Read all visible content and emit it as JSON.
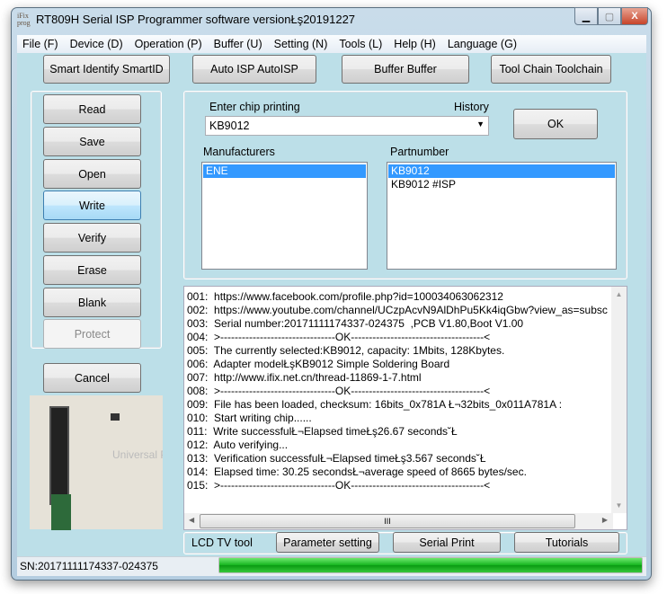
{
  "window": {
    "title": "RT809H Serial ISP Programmer software versionŁş20191227",
    "logo": "iFix prog",
    "controls": [
      "minimize",
      "maximize",
      "close"
    ]
  },
  "menu": [
    "File (F)",
    "Device (D)",
    "Operation (P)",
    "Buffer (U)",
    "Setting (N)",
    "Tools (L)",
    "Help (H)",
    "Language (G)"
  ],
  "toolbar": [
    "Smart Identify SmartID",
    "Auto ISP AutoISP",
    "Buffer Buffer",
    "Tool Chain Toolchain"
  ],
  "ops": {
    "buttons": [
      "Read",
      "Save",
      "Open",
      "Write",
      "Verify",
      "Erase",
      "Blank",
      "Protect"
    ],
    "active": "Write",
    "disabled": "Protect",
    "cancel": "Cancel"
  },
  "chip": {
    "label": "Enter chip printing",
    "history_label": "History",
    "value": "KB9012",
    "ok": "OK",
    "manufacturers_label": "Manufacturers",
    "manufacturers": [
      "ENE"
    ],
    "selected_manufacturer": "ENE",
    "partnumber_label": "Partnumber",
    "partnumbers": [
      "KB9012",
      "KB9012 #ISP"
    ],
    "selected_partnumber": "KB9012"
  },
  "log": [
    "001:  https://www.facebook.com/profile.php?id=100034063062312",
    "002:  https://www.youtube.com/channel/UCzpAcvN9AlDhPu5Kk4iqGbw?view_as=subsc",
    "003:  Serial number:20171111174337-024375  ,PCB V1.80,Boot V1.00",
    "004:  >--------------------------------OK-------------------------------------<",
    "005:  The currently selected:KB9012, capacity: 1Mbits, 128Kbytes.",
    "006:  Adapter modelŁşKB9012 Simple Soldering Board",
    "007:  http://www.ifix.net.cn/thread-11869-1-7.html",
    "008:  >--------------------------------OK-------------------------------------<",
    "009:  File has been loaded, checksum: 16bits_0x781A Ł¬32bits_0x011A781A :",
    "010:  Start writing chip......",
    "011:  Write successfulŁ¬Elapsed timeŁş26.67 seconds˘Ł",
    "012:  Auto verifying...",
    "013:  Verification successfulŁ¬Elapsed timeŁş3.567 seconds˘Ł",
    "014:  Elapsed time: 30.25 secondsŁ¬average speed of 8665 bytes/sec.",
    "015:  >--------------------------------OK-------------------------------------<"
  ],
  "bottom": {
    "lcd_label": "LCD TV tool",
    "buttons": [
      "Parameter setting",
      "Serial Print",
      "Tutorials"
    ]
  },
  "status": {
    "sn": "SN:20171111174337-024375",
    "progress_percent": 100,
    "progress_color": "#22c02a"
  },
  "image": {
    "caption": "Universal Programmer"
  }
}
